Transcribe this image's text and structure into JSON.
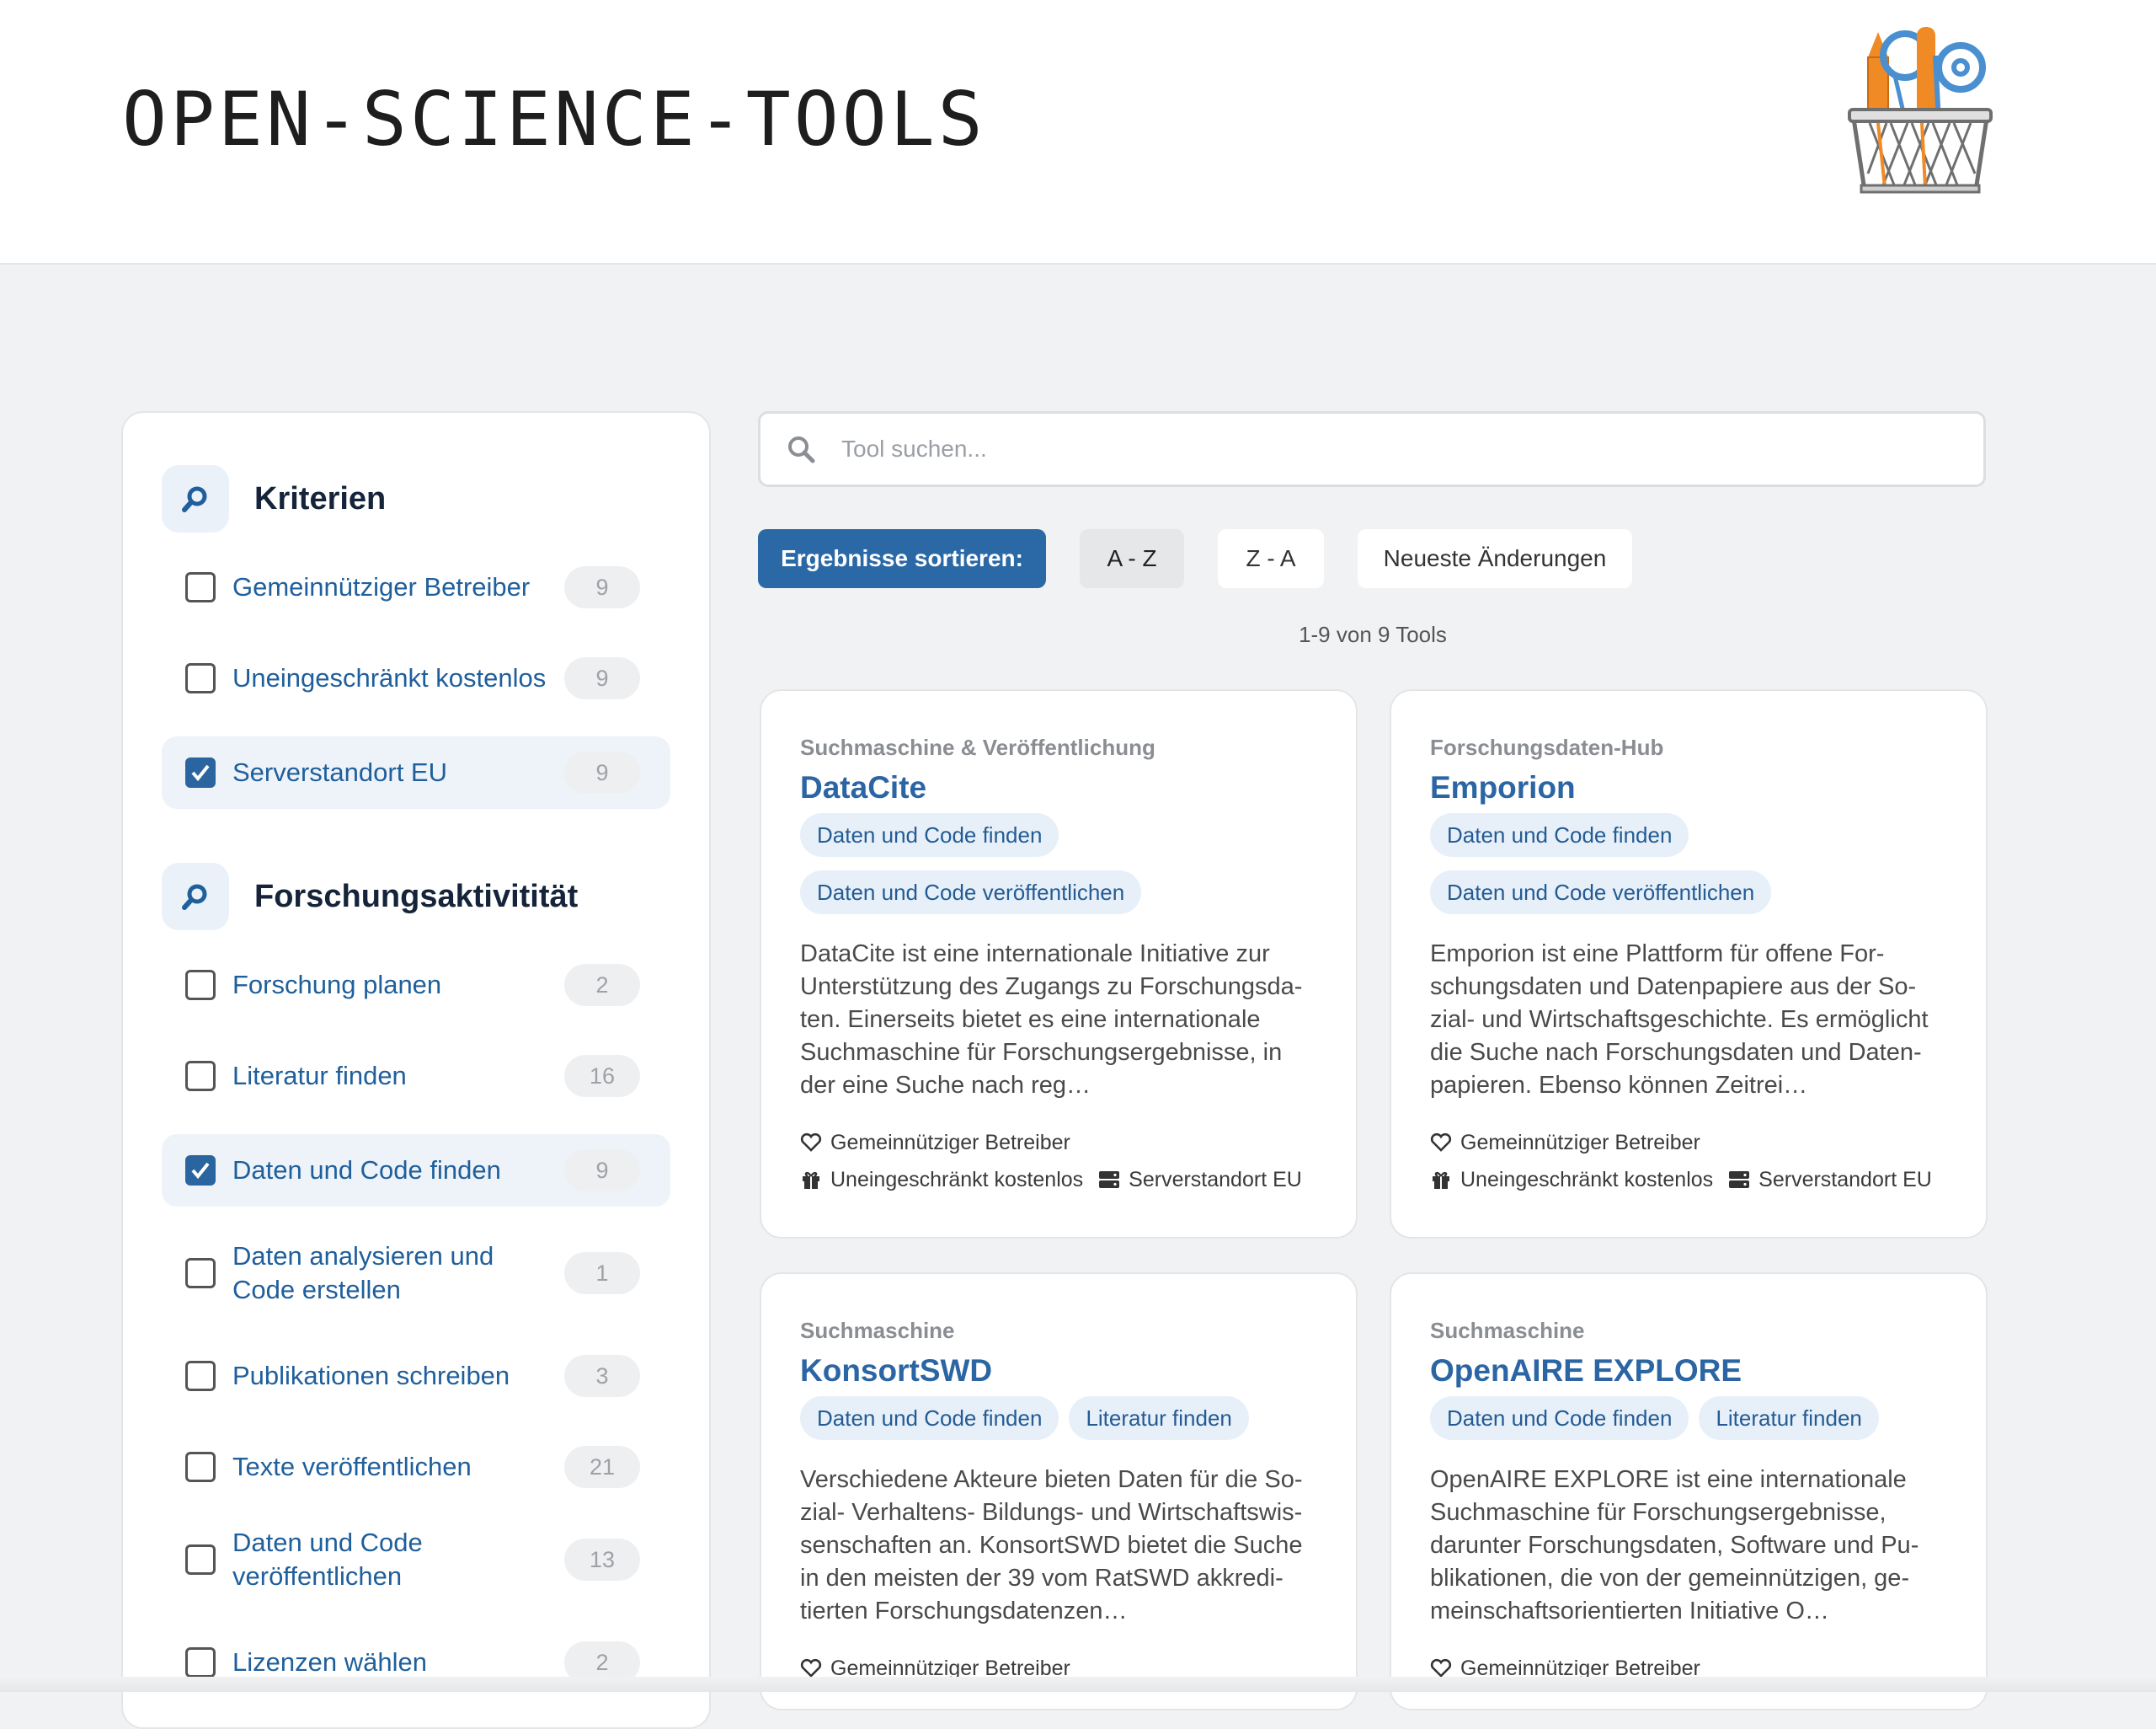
{
  "header": {
    "site_title": "OPEN-SCIENCE-TOOLS",
    "logo_icon": "pencil-basket-logo"
  },
  "sidebar": {
    "sections": [
      {
        "title": "Kriterien",
        "icon": "search-icon",
        "filters": [
          {
            "label": "Gemeinnütziger Betreiber",
            "count": "9",
            "checked": false
          },
          {
            "label": "Uneingeschränkt kostenlos",
            "count": "9",
            "checked": false
          },
          {
            "label": "Serverstandort EU",
            "count": "9",
            "checked": true
          }
        ]
      },
      {
        "title": "Forschungsaktivitität",
        "icon": "search-icon",
        "filters": [
          {
            "label": "Forschung planen",
            "count": "2",
            "checked": false
          },
          {
            "label": "Literatur finden",
            "count": "16",
            "checked": false
          },
          {
            "label": "Daten und Code finden",
            "count": "9",
            "checked": true
          },
          {
            "label": "Daten analysieren und Code erstellen",
            "count": "1",
            "checked": false
          },
          {
            "label": "Publikationen schreiben",
            "count": "3",
            "checked": false
          },
          {
            "label": "Texte veröffentlichen",
            "count": "21",
            "checked": false
          },
          {
            "label": "Daten und Code veröffentlichen",
            "count": "13",
            "checked": false
          },
          {
            "label": "Lizenzen wählen",
            "count": "2",
            "checked": false
          }
        ]
      }
    ]
  },
  "search": {
    "placeholder": "Tool suchen...",
    "value": ""
  },
  "sort": {
    "label": "Ergebnisse sortieren:",
    "options": [
      "A - Z",
      "Z - A",
      "Neueste Änderungen"
    ],
    "active": "A - Z"
  },
  "results": {
    "count_text": "1-9 von 9 Tools"
  },
  "cards": [
    {
      "category": "Suchmaschine & Veröffentlichung",
      "title": "DataCite",
      "tags": [
        "Daten und Code finden",
        "Daten und Code veröffentlichen"
      ],
      "description": "DataCite ist eine internationale Initiative zur Unterstützung des Zugangs zu Forschungsda­ten. Einerseits bietet es eine internationale Suchmaschine für Forschungsergebnisse, in der eine Suche nach reg…",
      "features": [
        "Gemeinnütziger Betreiber",
        "Uneingeschränkt kostenlos",
        "Serverstandort EU"
      ]
    },
    {
      "category": "Forschungsdaten-Hub",
      "title": "Emporion",
      "tags": [
        "Daten und Code finden",
        "Daten und Code veröffentlichen"
      ],
      "description": "Emporion ist eine Plattform für offene For­schungsdaten und Datenpapiere aus der So­zial- und Wirtschaftsgeschichte. Es ermöglicht die Suche nach Forschungsdaten und Daten­papieren. Ebenso können Zeitrei…",
      "features": [
        "Gemeinnütziger Betreiber",
        "Uneingeschränkt kostenlos",
        "Serverstandort EU"
      ]
    },
    {
      "category": "Suchmaschine",
      "title": "KonsortSWD",
      "tags": [
        "Daten und Code finden",
        "Literatur finden"
      ],
      "description": "Verschiedene Akteure bieten Daten für die So­zial- Verhaltens- Bildungs- und Wirtschaftswis­senschaften an. KonsortSWD bietet die Suche in den meisten der 39 vom RatSWD akkredi­tierten Forschungsdatenzen…",
      "features": [
        "Gemeinnütziger Betreiber"
      ]
    },
    {
      "category": "Suchmaschine",
      "title": "OpenAIRE EXPLORE",
      "tags": [
        "Daten und Code finden",
        "Literatur finden"
      ],
      "description": "OpenAIRE EXPLORE ist eine internationale Suchmaschine für Forschungsergebnisse, darunter Forschungsdaten, Software und Pu­blikationen, die von der gemeinnützigen, ge­meinschaftsorientierten Initiative O…",
      "features": [
        "Gemeinnütziger Betreiber"
      ]
    }
  ],
  "colors": {
    "accent": "#2b69a6",
    "link": "#1f5f9c",
    "tag_bg": "#e7f0f9",
    "page_bg": "#f1f2f3"
  }
}
